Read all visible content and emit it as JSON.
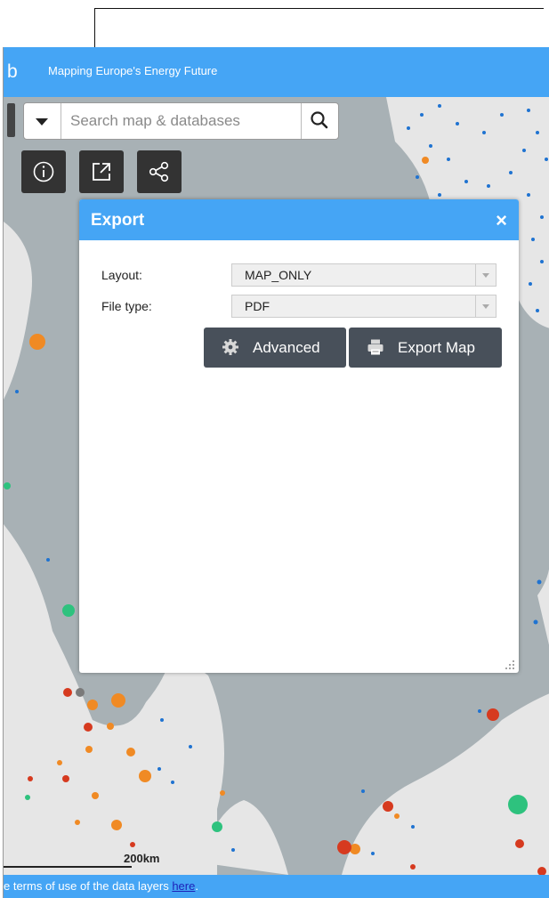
{
  "header": {
    "logo_fragment": "b",
    "title": "Mapping Europe's Energy Future"
  },
  "search": {
    "placeholder": "Search map & databases"
  },
  "toolbar": {
    "info_icon": "info-icon",
    "export_icon": "export-icon",
    "share_icon": "share-icon"
  },
  "export_panel": {
    "title": "Export",
    "close": "×",
    "layout_label": "Layout:",
    "layout_value": "MAP_ONLY",
    "filetype_label": "File type:",
    "filetype_value": "PDF",
    "advanced_label": "Advanced",
    "export_label": "Export Map"
  },
  "map": {
    "scale_label": "200km",
    "colors": {
      "sea": "#a8b1b5",
      "land": "#e6e6e6",
      "blue": "#1f73d1",
      "orange": "#f08a24",
      "red": "#d63a1f",
      "green": "#2ec27e",
      "gray": "#7a7a7a"
    }
  },
  "footer": {
    "text_before": "e terms of use of the data layers ",
    "link": "here",
    "text_after": "."
  }
}
